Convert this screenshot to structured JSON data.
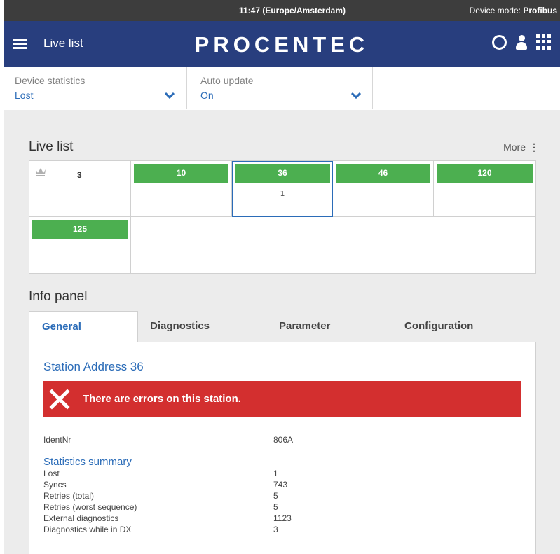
{
  "statusbar": {
    "clock": "11:47 (Europe/Amsterdam)",
    "mode_label": "Device mode:",
    "mode_value": "Profibus"
  },
  "navbar": {
    "title": "Live list",
    "logo": "PROCENTEC",
    "icons": [
      "menu-icon",
      "refresh-icon",
      "user-icon",
      "apps-grid-icon"
    ]
  },
  "filters": {
    "device_statistics": {
      "label": "Device statistics",
      "value": "Lost"
    },
    "auto_update": {
      "label": "Auto update",
      "value": "On"
    }
  },
  "livelist": {
    "title": "Live list",
    "more_label": "More",
    "master": {
      "address": "3",
      "icon": "crown-icon"
    },
    "stations": [
      {
        "address": "10",
        "status": "ok",
        "count": ""
      },
      {
        "address": "36",
        "status": "ok",
        "count": "1",
        "selected": true
      },
      {
        "address": "46",
        "status": "ok",
        "count": ""
      },
      {
        "address": "120",
        "status": "ok",
        "count": ""
      },
      {
        "address": "125",
        "status": "ok",
        "count": ""
      }
    ]
  },
  "info_panel": {
    "title": "Info panel",
    "tabs": [
      "General",
      "Diagnostics",
      "Parameter",
      "Configuration"
    ],
    "active_tab": "General",
    "station_title": "Station Address 36",
    "alert": "There are errors on this station.",
    "ident_label": "IdentNr",
    "ident_value": "806A",
    "stats_title": "Statistics summary",
    "stats": [
      {
        "label": "Lost",
        "value": "1"
      },
      {
        "label": "Syncs",
        "value": "743"
      },
      {
        "label": "Retries (total)",
        "value": "5"
      },
      {
        "label": "Retries (worst sequence)",
        "value": "5"
      },
      {
        "label": "External diagnostics",
        "value": "1123"
      },
      {
        "label": "Diagnostics while in DX",
        "value": "3"
      }
    ]
  },
  "colors": {
    "navbar": "#283e7e",
    "statusbar": "#3d3d3d",
    "accent_blue": "#2b6cb8",
    "station_ok_green": "#4caf50",
    "error_red": "#d32f2f",
    "content_bg": "#ececec"
  }
}
